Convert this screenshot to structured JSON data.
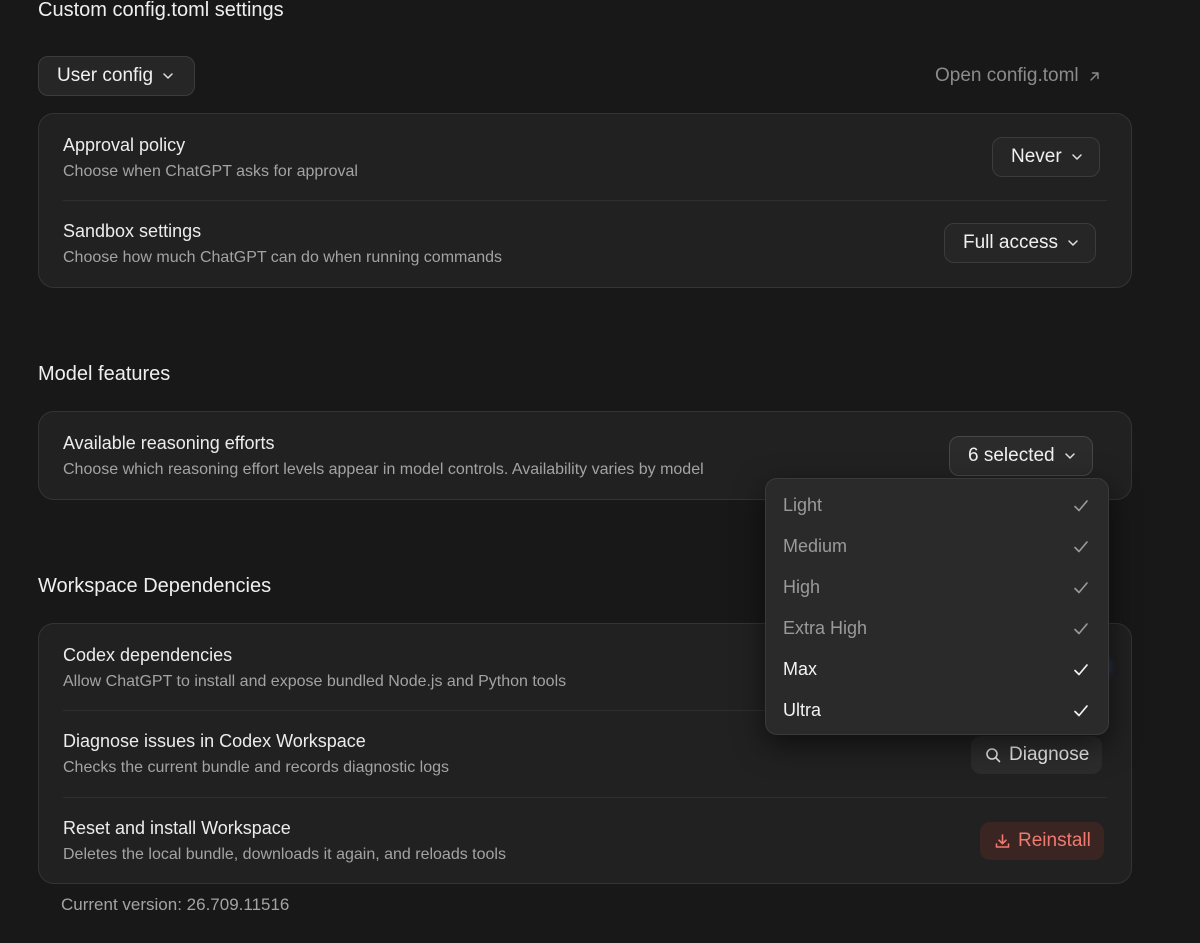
{
  "config": {
    "title": "Custom config.toml settings",
    "scope_select": "User config",
    "open_link": "Open config.toml",
    "approval": {
      "title": "Approval policy",
      "desc": "Choose when ChatGPT asks for approval",
      "value": "Never"
    },
    "sandbox": {
      "title": "Sandbox settings",
      "desc": "Choose how much ChatGPT can do when running commands",
      "value": "Full access"
    }
  },
  "model": {
    "title": "Model features",
    "reasoning": {
      "title": "Available reasoning efforts",
      "desc": "Choose which reasoning effort levels appear in model controls. Availability varies by model",
      "value": "6 selected"
    },
    "dropdown": {
      "items": [
        {
          "label": "Light",
          "checked": true
        },
        {
          "label": "Medium",
          "checked": true
        },
        {
          "label": "High",
          "checked": true
        },
        {
          "label": "Extra High",
          "checked": true
        },
        {
          "label": "Max",
          "checked": true
        },
        {
          "label": "Ultra",
          "checked": true
        }
      ]
    }
  },
  "workspace": {
    "title": "Workspace Dependencies",
    "codex": {
      "title": "Codex dependencies",
      "desc": "Allow ChatGPT to install and expose bundled Node.js and Python tools"
    },
    "diagnose": {
      "title": "Diagnose issues in Codex Workspace",
      "desc": "Checks the current bundle and records diagnostic logs",
      "button": "Diagnose"
    },
    "reset": {
      "title": "Reset and install Workspace",
      "desc": "Deletes the local bundle, downloads it again, and reloads tools",
      "button": "Reinstall"
    },
    "version": "Current version: 26.709.11516"
  },
  "colors": {
    "background": "#181818",
    "card": "#212121",
    "danger_text": "#f07a70",
    "danger_bg": "#3a2522",
    "toggle_accent": "#3b82f6"
  }
}
